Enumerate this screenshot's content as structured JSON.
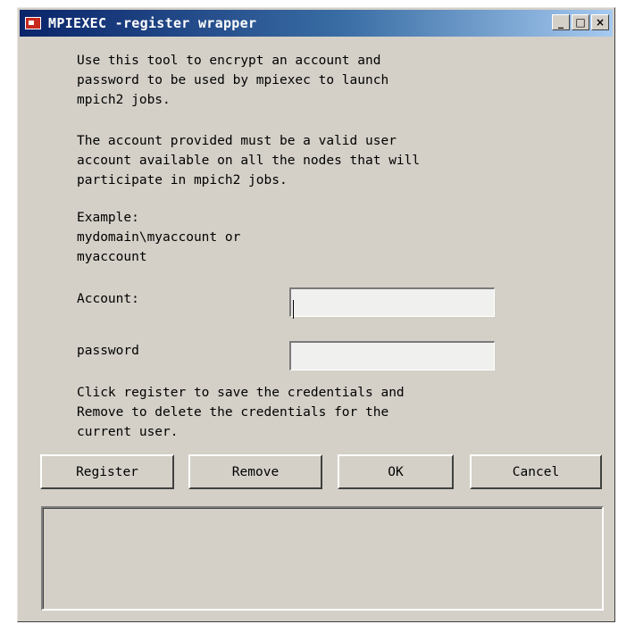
{
  "window": {
    "title": "MPIEXEC -register wrapper",
    "controls": {
      "minimize": "_",
      "maximize": "□",
      "close": "×"
    }
  },
  "intro_text": "Use this tool to encrypt an account and\npassword to be used by mpiexec to launch\nmpich2 jobs.",
  "account_note": "The account provided must be a valid user\naccount available on all the nodes that will\nparticipate in mpich2 jobs.",
  "example_text": "Example:\nmydomain\\myaccount or\nmyaccount",
  "form": {
    "account_label": "Account:",
    "account_value": "",
    "password_label": "password",
    "password_value": ""
  },
  "instructions": "Click register to save the credentials and\nRemove to delete the credentials for the\ncurrent user.",
  "buttons": {
    "register": "Register",
    "remove": "Remove",
    "ok": "OK",
    "cancel": "Cancel"
  },
  "output_text": ""
}
